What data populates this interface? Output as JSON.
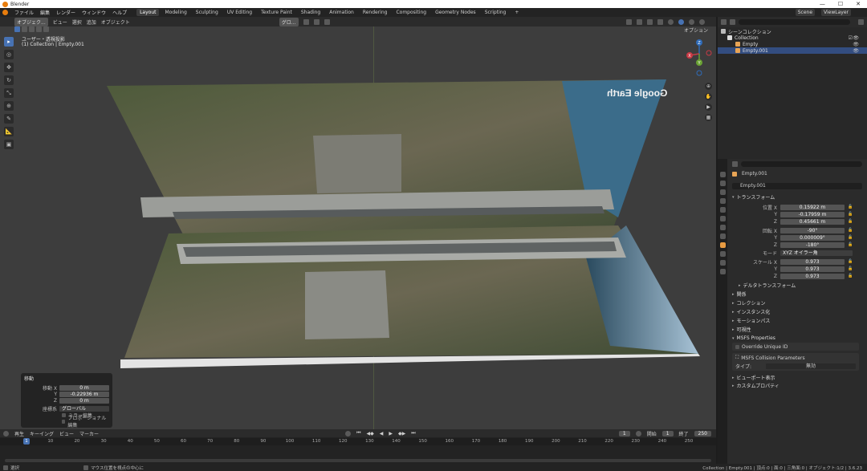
{
  "titlebar": {
    "app": "Blender",
    "minimize": "—",
    "maximize": "☐",
    "close": "✕"
  },
  "topmenu": {
    "items": [
      "ファイル",
      "編集",
      "レンダー",
      "ウィンドウ",
      "ヘルプ"
    ],
    "workspaces": [
      "Layout",
      "Modeling",
      "Sculpting",
      "UV Editing",
      "Texture Paint",
      "Shading",
      "Animation",
      "Rendering",
      "Compositing",
      "Geometry Nodes",
      "Scripting"
    ],
    "add_tab": "+",
    "scene": "Scene",
    "view_layer": "ViewLayer"
  },
  "viewport": {
    "mode": "オブジェク...",
    "menus": [
      "ビュー",
      "選択",
      "追加",
      "オブジェクト"
    ],
    "transform_orient": "グロ...",
    "view_name": "ユーザー・透視投影",
    "collection_info": "(1) Collection | Empty.001",
    "options": "オプション",
    "watermark": "Google Earth",
    "axis": {
      "x": "X",
      "y": "Y",
      "z": "Z"
    }
  },
  "toolbar": {
    "tools": [
      "select-tool",
      "cursor-tool",
      "move-tool",
      "rotate-tool",
      "scale-tool",
      "transform-tool",
      "annotate-tool",
      "measure-tool",
      "add-cube-tool"
    ]
  },
  "operator_panel": {
    "title": "移動",
    "move_x_label": "移動 X",
    "move_x": "0 m",
    "move_y_label": "Y",
    "move_y": "-0.22936 m",
    "move_z_label": "Z",
    "move_z": "0 m",
    "orient_label": "座標系",
    "orient_value": "グローバル",
    "mirror_label": "ミラー編集",
    "proportional_label": "プロポーショナル編集"
  },
  "outliner": {
    "rows": [
      {
        "label": "シーンコレクション"
      },
      {
        "label": "Collection"
      },
      {
        "label": "Empty"
      },
      {
        "label": "Empty.001"
      }
    ]
  },
  "properties": {
    "object_name_header": "Empty.001",
    "object_name": "Empty.001",
    "transform_title": "トランスフォーム",
    "location_label": "位置 X",
    "loc_x": "0.15922 m",
    "loc_y": "-0.17959 m",
    "loc_z": "0.45661 m",
    "rotation_label": "回転 X",
    "rot_x": "-90°",
    "rot_y": "0.000009°",
    "rot_z": "-180°",
    "mode_label": "モード",
    "mode_value": "XYZ オイラー角",
    "scale_label": "スケール X",
    "scale_x": "0.973",
    "scale_y": "0.973",
    "scale_z": "0.973",
    "y_label": "Y",
    "z_label": "Z",
    "delta_transform": "デルタトランスフォーム",
    "sections": [
      "関係",
      "コレクション",
      "インスタンス化",
      "モーションパス",
      "可視性"
    ],
    "msfs_title": "MSFS Properties",
    "override_uid": "Override Unique ID",
    "collision_title": "MSFS Collision Parameters",
    "type_label": "タイプ:",
    "type_value": "無効",
    "viewport_display": "ビューポート表示",
    "custom_props": "カスタムプロパティ"
  },
  "timeline": {
    "menus": [
      "再生",
      "キーイング",
      "ビュー",
      "マーカー"
    ],
    "current_frame": "1",
    "start_label": "開始",
    "start": "1",
    "end_label": "終了",
    "end": "250",
    "ticks": [
      "1",
      "10",
      "20",
      "30",
      "40",
      "50",
      "60",
      "70",
      "80",
      "90",
      "100",
      "110",
      "120",
      "130",
      "140",
      "150",
      "160",
      "170",
      "180",
      "190",
      "200",
      "210",
      "220",
      "230",
      "240",
      "250"
    ]
  },
  "statusbar": {
    "left": "選択",
    "mid": "マウス位置を視点の中心に",
    "right": "Collection | Empty.001 | 頂点:0 | 面:0 | 三角面:0 | オブジェクト:1/2 | 3.6.23"
  }
}
